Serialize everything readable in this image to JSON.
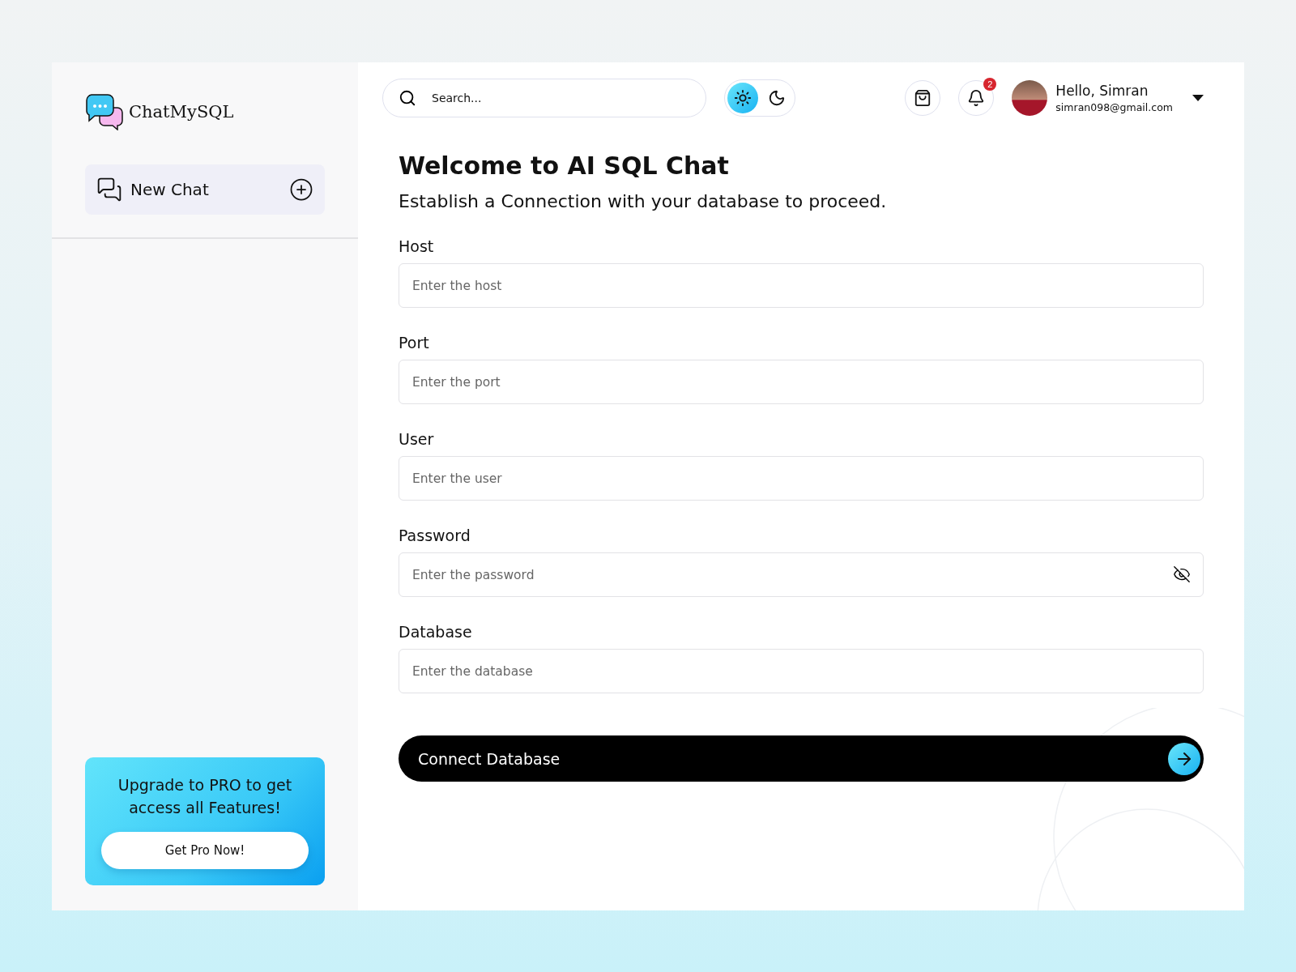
{
  "sidebar": {
    "logo": "ChatMySQL",
    "new_chat": "New Chat",
    "promo": {
      "text": "Upgrade to  PRO to get access all Features!",
      "button": "Get Pro Now!"
    }
  },
  "header": {
    "search": {
      "placeholder": "Search..."
    },
    "theme_toggle": [
      {
        "kind": "light",
        "selected": true
      },
      {
        "kind": "dark",
        "selected": false
      }
    ],
    "notifications": {
      "count": "2"
    },
    "user": {
      "greeting": "Hello, Simran",
      "email": "simran098@gmail.com"
    }
  },
  "main": {
    "title": "Welcome to AI SQL Chat",
    "subtitle": "Establish a Connection with your database to proceed.",
    "fields": [
      {
        "label": "Host",
        "placeholder": "Enter the host",
        "kind": "text"
      },
      {
        "label": "Port",
        "placeholder": "Enter the port",
        "kind": "text"
      },
      {
        "label": "User",
        "placeholder": "Enter the user",
        "kind": "text"
      },
      {
        "label": "Password",
        "placeholder": "Enter the password",
        "kind": "password"
      },
      {
        "label": "Database",
        "placeholder": "Enter the database",
        "kind": "text"
      }
    ],
    "submit": "Connect Database"
  }
}
